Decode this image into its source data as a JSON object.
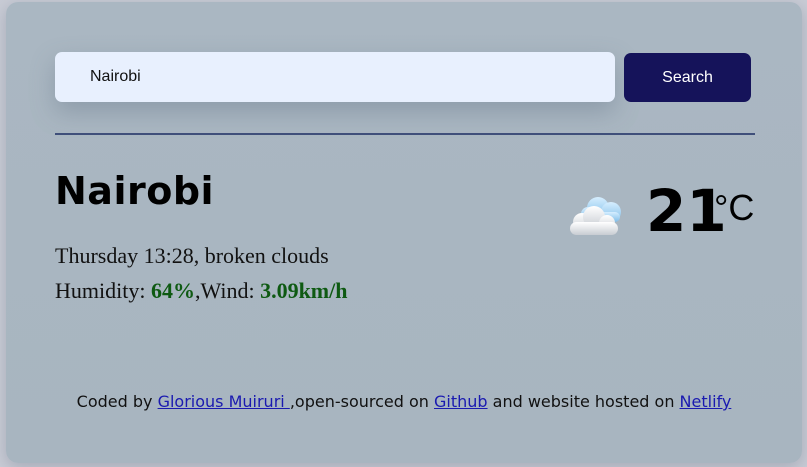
{
  "search": {
    "value": "Nairobi",
    "button_label": "Search"
  },
  "weather": {
    "city": "Nairobi",
    "day_time": "Thursday 13:28",
    "description": "broken clouds",
    "humidity_label": "Humidity:",
    "humidity_value": "64%",
    "wind_label": "Wind:",
    "wind_value": "3.09km/h",
    "temperature": "21",
    "unit": "°C",
    "icon": "broken-clouds-icon"
  },
  "footer": {
    "coded_by": "Coded by ",
    "author": "Glorious Muiruri ",
    "open_sourced": ",open-sourced on ",
    "github": "Github",
    "hosted": " and website hosted on ",
    "netlify": "Netlify"
  },
  "colors": {
    "accent_button": "#15135a",
    "highlight_value": "#0e5a12",
    "link": "#1a1ab0"
  }
}
